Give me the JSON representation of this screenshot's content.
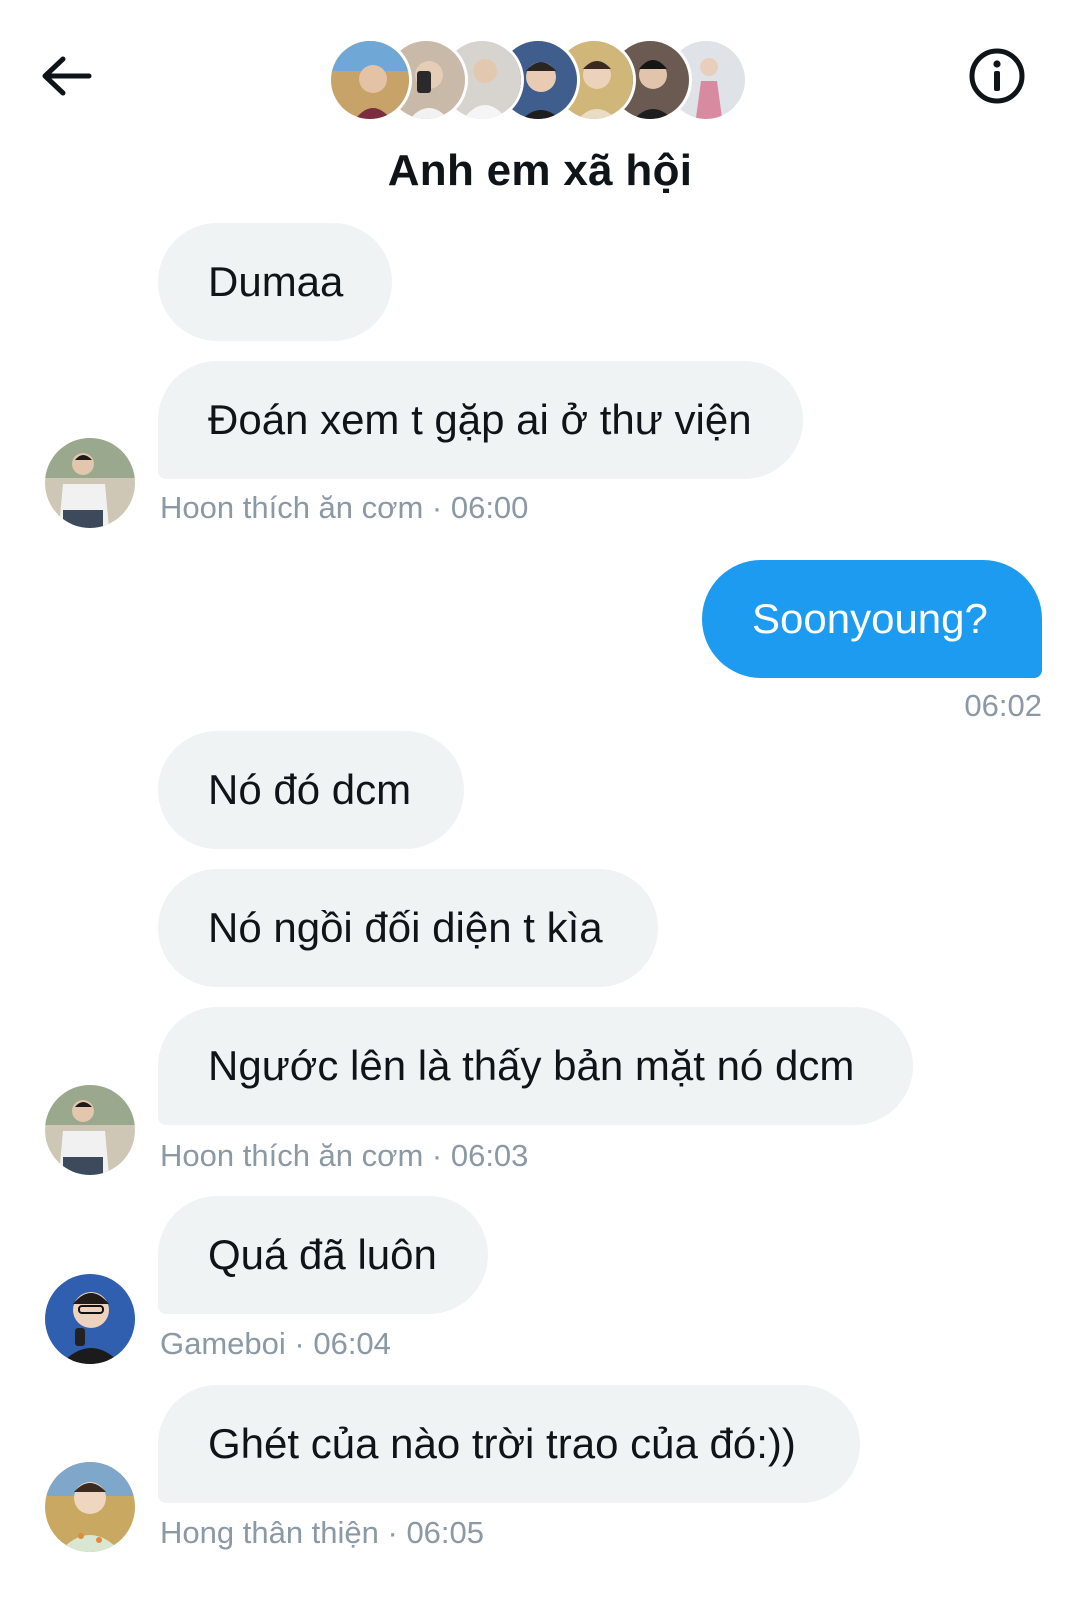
{
  "header": {
    "back_icon": "arrow-left-icon",
    "info_icon": "info-circle-icon",
    "title": "Anh em xã hội",
    "member_avatars": [
      {
        "bg": "#8a6a4f",
        "fg": "#7a2d3e"
      },
      {
        "bg": "#c9b9a8",
        "fg": "#3b3b3b"
      },
      {
        "bg": "#d7d4cf",
        "fg": "#f2f2f2"
      },
      {
        "bg": "#3f5e8e",
        "fg": "#1d1d1d"
      },
      {
        "bg": "#d1b67a",
        "fg": "#e8dcc4"
      },
      {
        "bg": "#6b5a52",
        "fg": "#1e1e1e"
      },
      {
        "bg": "#dfe3e8",
        "fg": "#d88ba0"
      }
    ]
  },
  "colors": {
    "incoming_bubble": "#eff3f4",
    "outgoing_bubble": "#1d9bf0",
    "meta_text": "#8b98a5"
  },
  "messages": [
    {
      "text": "Dumaa"
    },
    {
      "text": "Đoán xem t gặp ai ở thư viện"
    },
    {
      "meta": "Hoon thích ăn cơm · 06:00"
    },
    {
      "text": "Soonyoung?"
    },
    {
      "meta": "06:02"
    },
    {
      "text": "Nó đó dcm"
    },
    {
      "text": "Nó ngồi đối diện t kìa"
    },
    {
      "text": "Ngước lên là thấy bản mặt nó dcm"
    },
    {
      "meta": "Hoon thích ăn cơm · 06:03"
    },
    {
      "text": "Quá đã luôn"
    },
    {
      "meta": "Gameboi · 06:04"
    },
    {
      "text": "Ghét của nào trời trao của đó:))"
    },
    {
      "meta": "Hong thân thiện · 06:05"
    }
  ]
}
